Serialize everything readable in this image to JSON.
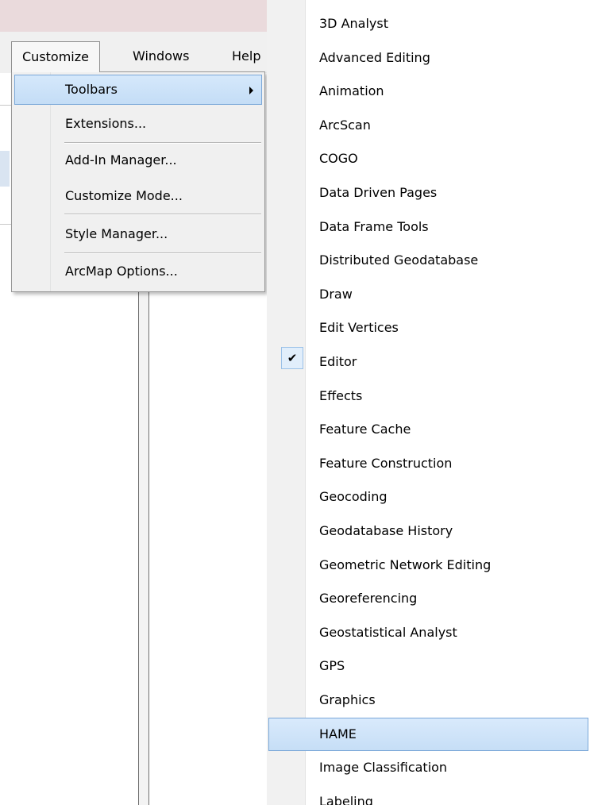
{
  "menubar": {
    "items": [
      {
        "label": "Customize"
      },
      {
        "label": "Windows"
      },
      {
        "label": "Help"
      }
    ]
  },
  "customize_menu": {
    "items": [
      {
        "label": "Toolbars",
        "highlighted": true,
        "has_submenu": true
      },
      {
        "label": "Extensions..."
      },
      {
        "label": "Add-In Manager..."
      },
      {
        "label": "Customize Mode..."
      },
      {
        "label": "Style Manager..."
      },
      {
        "label": "ArcMap Options..."
      }
    ]
  },
  "toolbars_submenu": {
    "items": [
      {
        "label": "3D Analyst"
      },
      {
        "label": "Advanced Editing"
      },
      {
        "label": "Animation"
      },
      {
        "label": "ArcScan"
      },
      {
        "label": "COGO"
      },
      {
        "label": "Data Driven Pages"
      },
      {
        "label": "Data Frame Tools"
      },
      {
        "label": "Distributed Geodatabase"
      },
      {
        "label": "Draw"
      },
      {
        "label": "Edit Vertices"
      },
      {
        "label": "Editor",
        "checked": true
      },
      {
        "label": "Effects"
      },
      {
        "label": "Feature Cache"
      },
      {
        "label": "Feature Construction"
      },
      {
        "label": "Geocoding"
      },
      {
        "label": "Geodatabase History"
      },
      {
        "label": "Geometric Network Editing"
      },
      {
        "label": "Georeferencing"
      },
      {
        "label": "Geostatistical Analyst"
      },
      {
        "label": "GPS"
      },
      {
        "label": "Graphics"
      },
      {
        "label": "HAME",
        "highlighted": true
      },
      {
        "label": "Image Classification"
      },
      {
        "label": "Labeling"
      }
    ],
    "check_glyph": "✔"
  },
  "colors": {
    "highlight": "#cce4f7",
    "highlight_border": "#7aa7d8",
    "menu_bg": "#f0f0f0"
  }
}
